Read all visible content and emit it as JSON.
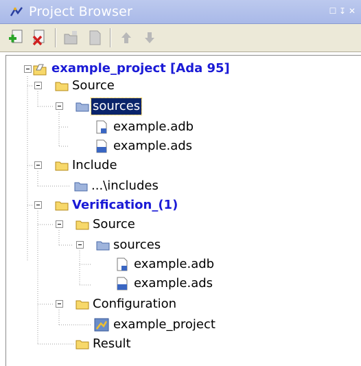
{
  "window": {
    "title": "Project Browser",
    "controls": [
      "☐",
      "↧",
      "✕"
    ]
  },
  "toolbar": {
    "buttons": [
      "new-project",
      "delete",
      "add-folder",
      "add-file",
      "move-up",
      "move-down"
    ]
  },
  "tree": {
    "project": "example_project [Ada 95]",
    "source": "Source",
    "sources": "sources",
    "file_adb": "example.adb",
    "file_ads": "example.ads",
    "include": "Include",
    "includes": "...\\includes",
    "verification": "Verification_(1)",
    "v_source": "Source",
    "v_sources": "sources",
    "v_file_adb": "example.adb",
    "v_file_ads": "example.ads",
    "configuration": "Configuration",
    "config_item": "example_project",
    "result": "Result"
  },
  "colors": {
    "accent": "#1a1ad6",
    "title_bar": "#b2c1ec",
    "selection": "#0a246a"
  }
}
